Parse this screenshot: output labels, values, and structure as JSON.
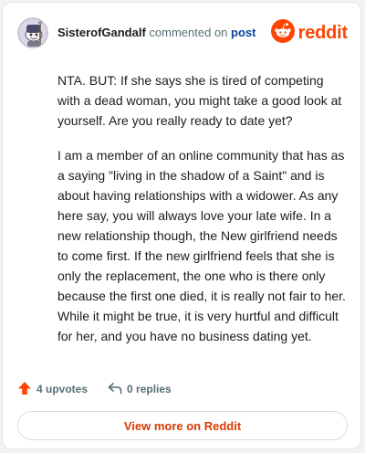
{
  "header": {
    "author": "SisterofGandalf",
    "commented_on": "commented on",
    "post_link": "post",
    "brand": "reddit",
    "avatar_icon": "snoo-avatar-icon",
    "brand_icon": "reddit-logo-icon"
  },
  "comment": {
    "paragraphs": [
      "NTA. BUT: If she says she is tired of competing with a dead woman, you might take a good look at yourself. Are you really ready to date yet?",
      "I am a member of an online community that has as a saying \"living in the shadow of a Saint\" and is about having relationships with a widower. As any here say, you will always love your late wife. In a new relationship though, the New girlfriend needs to come first. If the new girlfriend feels that she is only the replacement, the one who is there only because the first one died, it is really not fair to her. While it might be true, it is very hurtful and difficult for her, and you have no business dating yet."
    ]
  },
  "actions": {
    "upvotes": "4 upvotes",
    "replies": "0 replies",
    "upvote_icon": "upvote-arrow-icon",
    "reply_icon": "reply-arrow-icon"
  },
  "footer": {
    "view_more": "View more on Reddit"
  },
  "colors": {
    "brand": "#ff4500",
    "link": "#0a449b",
    "view_more": "#d93900",
    "muted": "#576f76"
  }
}
